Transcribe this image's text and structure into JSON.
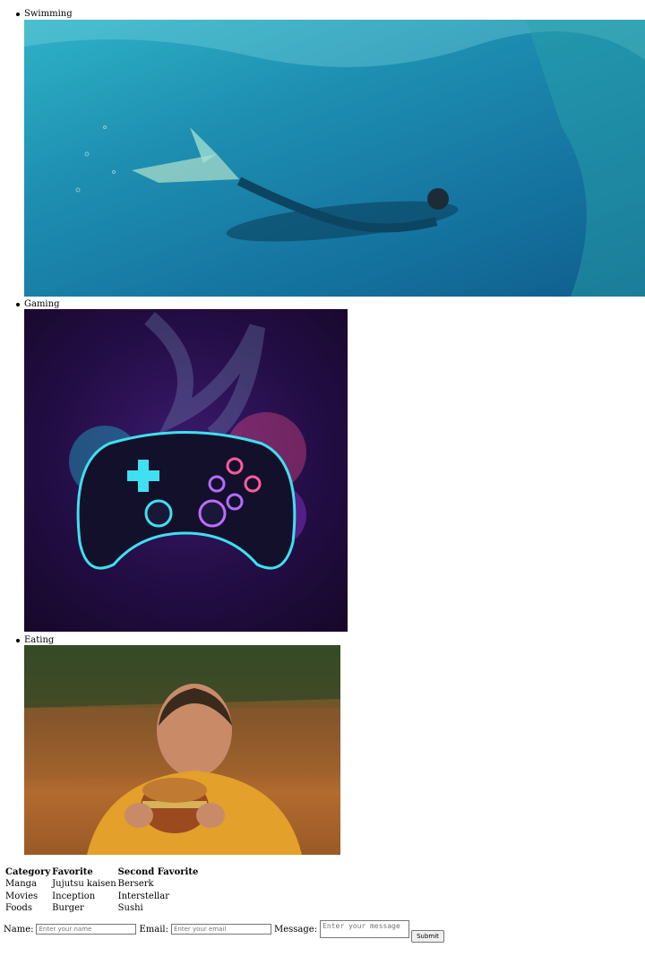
{
  "hobbies": [
    {
      "label": "Swimming"
    },
    {
      "label": "Gaming"
    },
    {
      "label": "Eating"
    }
  ],
  "favorites_table": {
    "headers": [
      "Category",
      "Favorite",
      "Second Favorite"
    ],
    "rows": [
      [
        "Manga",
        "Jujutsu kaisen",
        "Berserk"
      ],
      [
        "Movies",
        "Inception",
        "Interstellar"
      ],
      [
        "Foods",
        "Burger",
        "Sushi"
      ]
    ]
  },
  "contact_form": {
    "name_label": "Name:",
    "name_placeholder": "Enter your name",
    "email_label": "Email:",
    "email_placeholder": "Enter your email",
    "message_label": "Message:",
    "message_placeholder": "Enter your message",
    "submit_label": "Submit"
  }
}
